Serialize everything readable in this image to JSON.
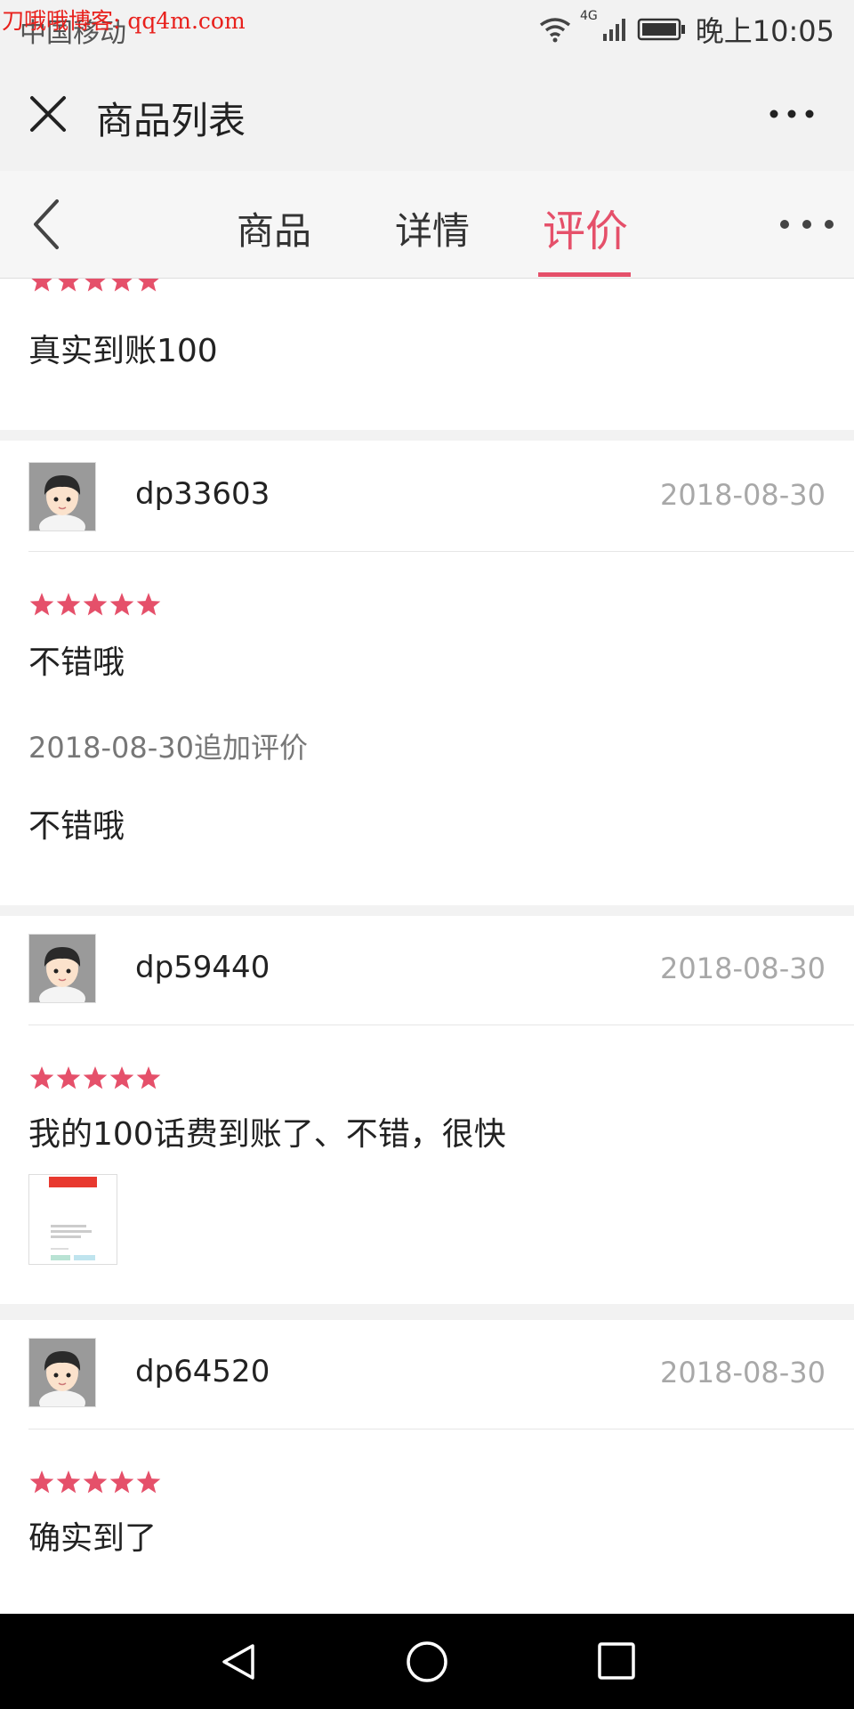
{
  "status_bar": {
    "carrier": "中国移动",
    "network": "4G",
    "time": "晚上10:05",
    "watermark": "刀哦哦博客: qq4m.com"
  },
  "title_bar": {
    "title": "商品列表",
    "close_icon": "close-icon",
    "more_icon": "more-icon"
  },
  "tabs": {
    "items": [
      {
        "label": "商品",
        "active": false
      },
      {
        "label": "详情",
        "active": false
      },
      {
        "label": "评价",
        "active": true
      }
    ],
    "accent_color": "#e5506a"
  },
  "reviews": [
    {
      "user": "",
      "date": "",
      "rating": 5,
      "comment": "真实到账100"
    },
    {
      "user": "dp33603",
      "date": "2018-08-30",
      "rating": 5,
      "comment": "不错哦",
      "append_label": "2018-08-30追加评价",
      "append_comment": "不错哦"
    },
    {
      "user": "dp59440",
      "date": "2018-08-30",
      "rating": 5,
      "comment": "我的100话费到账了、不错，很快",
      "has_image": true
    },
    {
      "user": "dp64520",
      "date": "2018-08-30",
      "rating": 5,
      "comment": "确实到了"
    }
  ],
  "nav_bar": {
    "icons": [
      "back-triangle-icon",
      "home-circle-icon",
      "recent-square-icon"
    ]
  }
}
